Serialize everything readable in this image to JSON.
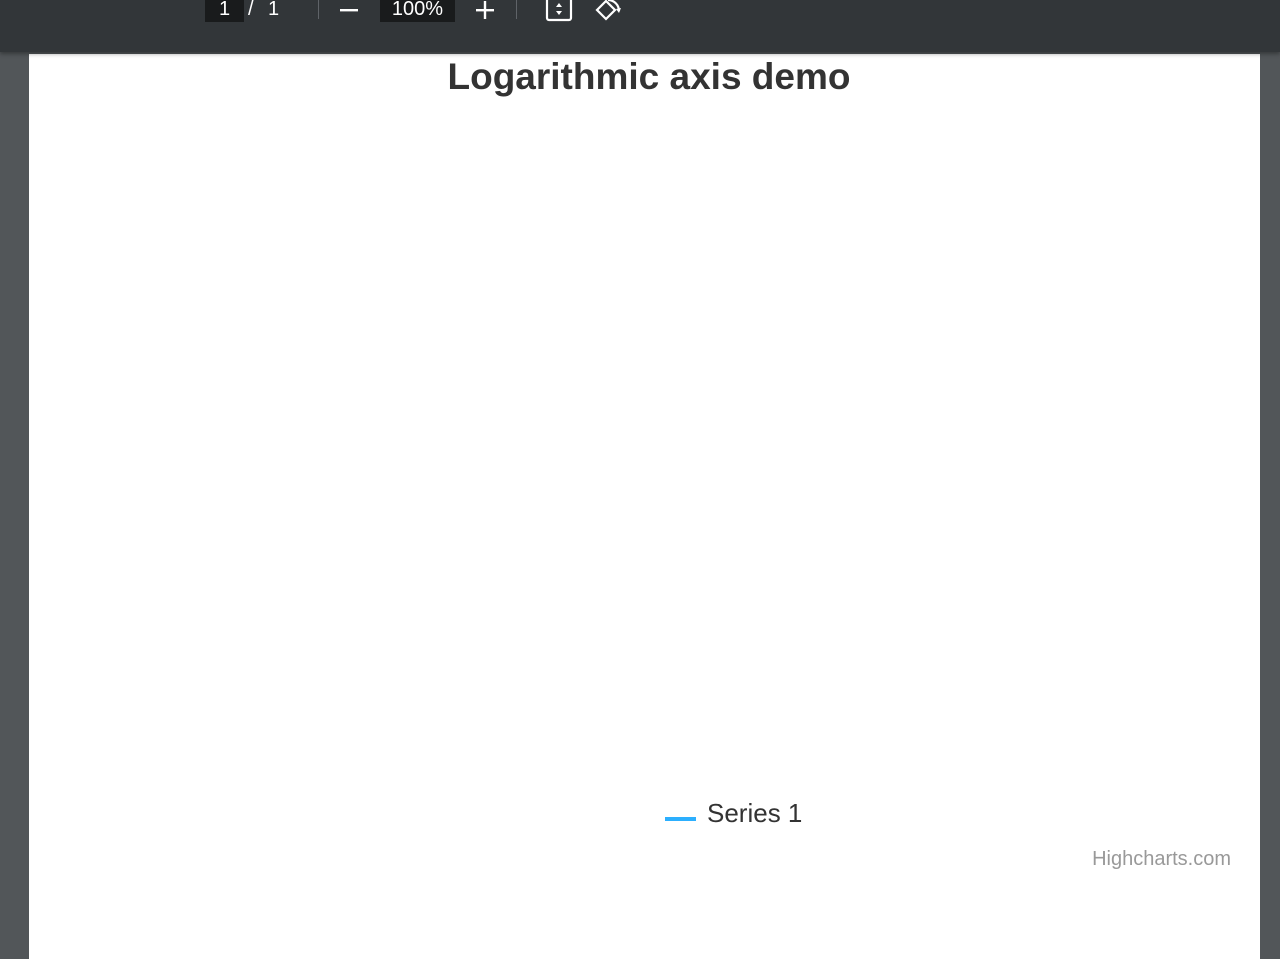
{
  "toolbar": {
    "page_current": "1",
    "page_separator": "/",
    "page_total": "1",
    "zoom_value": "100%"
  },
  "chart_data": {
    "type": "line",
    "title": "Logarithmic axis demo",
    "series": [
      {
        "name": "Series 1",
        "values": []
      }
    ],
    "legend": "bottom-center",
    "color": "#2caffe",
    "credits": "Highcharts.com"
  }
}
